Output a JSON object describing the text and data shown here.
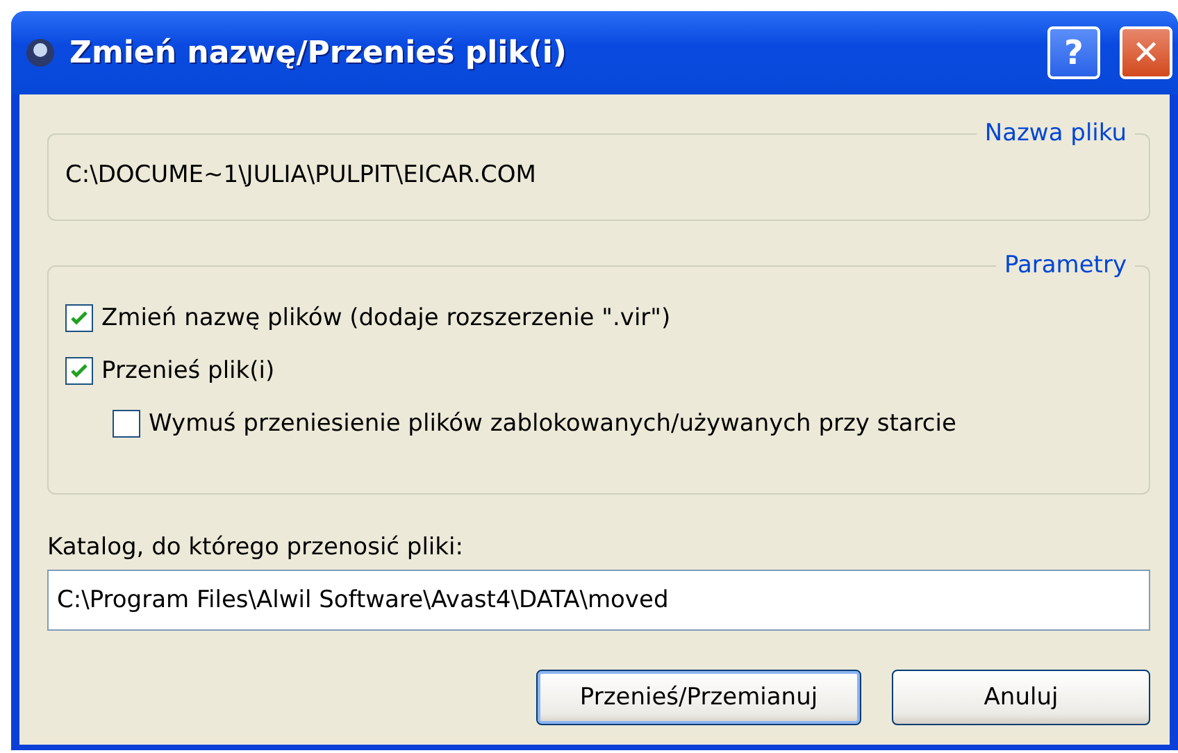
{
  "window": {
    "title": "Zmień nazwę/Przenieś plik(i)",
    "buttons": [
      "?",
      "✕"
    ]
  },
  "file_group": {
    "legend": "Nazwa pliku",
    "path": "C:\\DOCUME~1\\JULIA\\PULPIT\\EICAR.COM"
  },
  "params_group": {
    "legend": "Parametry",
    "options": [
      {
        "label": "Zmień nazwę plików (dodaje rozszerzenie \".vir\")",
        "checked": true
      },
      {
        "label": "Przenieś plik(i)",
        "checked": true,
        "children": [
          {
            "label": "Wymuś przeniesienie plików zablokowanych/używanych przy starcie",
            "checked": false
          }
        ]
      }
    ]
  },
  "folder": {
    "label": "Katalog, do którego przenosić pliki:",
    "value": "C:\\Program Files\\Alwil Software\\Avast4\\DATA\\moved"
  },
  "buttons": [
    {
      "label": "Przenieś/Przemianuj",
      "selected": true
    },
    {
      "label": "Anuluj",
      "selected": false
    }
  ]
}
